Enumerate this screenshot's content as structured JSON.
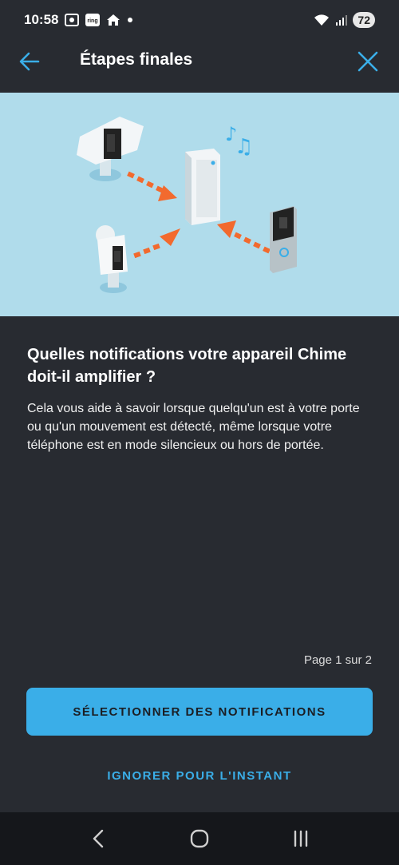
{
  "status_bar": {
    "time": "10:58",
    "battery": "72",
    "icons": [
      "screen-record-icon",
      "ring-app-icon",
      "home-icon",
      "dot-icon",
      "wifi-icon",
      "signal-icon"
    ]
  },
  "header": {
    "title": "Étapes finales",
    "back_icon": "arrow-left-icon",
    "close_icon": "close-icon"
  },
  "hero": {
    "illustration": "chime-devices-illustration"
  },
  "main": {
    "headline": "Quelles notifications votre appareil Chime doit-il amplifier ?",
    "body": "Cela vous aide à savoir lorsque quelqu'un est à votre porte ou qu'un mouvement est détecté, même lorsque votre téléphone est en mode silencieux ou hors de portée."
  },
  "footer": {
    "page_indicator": "Page 1 sur 2",
    "primary_button": "SÉLECTIONNER DES NOTIFICATIONS",
    "secondary_link": "IGNORER POUR L'INSTANT"
  },
  "nav": {
    "back": "nav-back-icon",
    "home": "nav-home-icon",
    "recents": "nav-recents-icon"
  },
  "colors": {
    "background": "#282b31",
    "accent": "#3aaee8",
    "hero_bg": "#b0dceb",
    "arrow_orange": "#f26a2e"
  }
}
